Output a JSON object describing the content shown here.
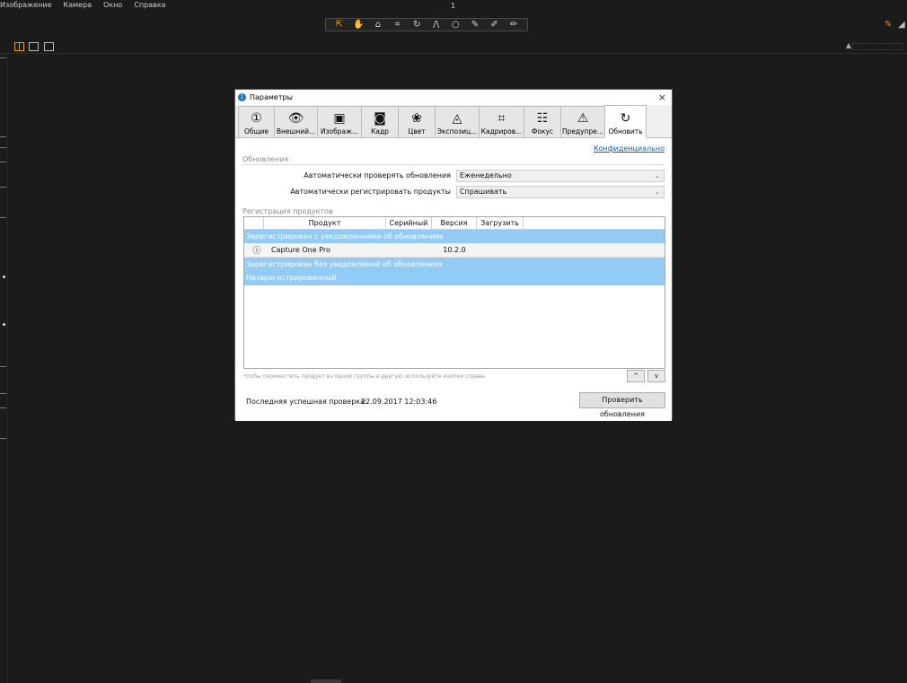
{
  "menu": [
    "Изображение",
    "Камера",
    "Окно",
    "Справка"
  ],
  "window_number": "1",
  "tools": [
    {
      "icon": "cursor-icon",
      "glyph": "⇱",
      "active": true
    },
    {
      "icon": "hand-icon",
      "glyph": "✋",
      "active": false
    },
    {
      "icon": "loupe-icon",
      "glyph": "⌂",
      "active": false
    },
    {
      "icon": "crop-icon",
      "glyph": "⌗",
      "active": false
    },
    {
      "icon": "rotate-icon",
      "glyph": "↻",
      "active": false
    },
    {
      "icon": "keystone-icon",
      "glyph": "/\\",
      "active": false
    },
    {
      "icon": "spot-icon",
      "glyph": "○",
      "active": false
    },
    {
      "icon": "brush-icon",
      "glyph": "✎",
      "active": false
    },
    {
      "icon": "eyedropper-icon",
      "glyph": "✐",
      "active": false
    },
    {
      "icon": "annotate-icon",
      "glyph": "✏",
      "active": false
    }
  ],
  "dialog": {
    "title": "Параметры",
    "close": "×",
    "tabs": [
      {
        "label": "Общие",
        "icon": "general-icon",
        "glyph": "①"
      },
      {
        "label": "Внешний...",
        "icon": "eye-icon",
        "glyph": "👁"
      },
      {
        "label": "Изображ...",
        "icon": "image-icon",
        "glyph": "▣"
      },
      {
        "label": "Кадр",
        "icon": "camera-icon",
        "glyph": "◙"
      },
      {
        "label": "Цвет",
        "icon": "color-icon",
        "glyph": "❀"
      },
      {
        "label": "Экспозиц...",
        "icon": "exposure-icon",
        "glyph": "◬"
      },
      {
        "label": "Кадриров...",
        "icon": "crop-icon",
        "glyph": "⌗"
      },
      {
        "label": "Фокус",
        "icon": "focus-icon",
        "glyph": "☷"
      },
      {
        "label": "Предупре...",
        "icon": "warning-icon",
        "glyph": "⚠"
      },
      {
        "label": "Обновить",
        "icon": "update-icon",
        "glyph": "↻"
      }
    ],
    "active_tab": 9,
    "privacy_link": "Конфиденциально",
    "updates_section": "Обновления",
    "auto_check_label": "Автоматически проверять обновления",
    "auto_check_value": "Еженедельно",
    "auto_register_label": "Автоматически регистрировать продукты",
    "auto_register_value": "Спрашивать",
    "registration_section": "Регистрация продуктов",
    "columns": [
      "Продукт",
      "Серийный",
      "Версия",
      "Загрузить"
    ],
    "groups": [
      {
        "label": "Зарегистрирован с уведомлениями об обновлениях",
        "products": [
          {
            "name": "Capture One Pro",
            "serial": "",
            "version": "10.2.0",
            "download": ""
          }
        ]
      },
      {
        "label": "Зарегистрирован без уведомлений об обновлениях",
        "products": []
      },
      {
        "label": "Незарегистрированный",
        "products": []
      }
    ],
    "hint": "Чтобы переместить продукт из одной группы в другую, используйте кнопки справа",
    "move_up": "^",
    "move_down": "v",
    "last_check_label": "Последняя успешная проверка:",
    "last_check_value": "22.09.2017 12:03:46",
    "check_button": "Проверить обновления"
  }
}
